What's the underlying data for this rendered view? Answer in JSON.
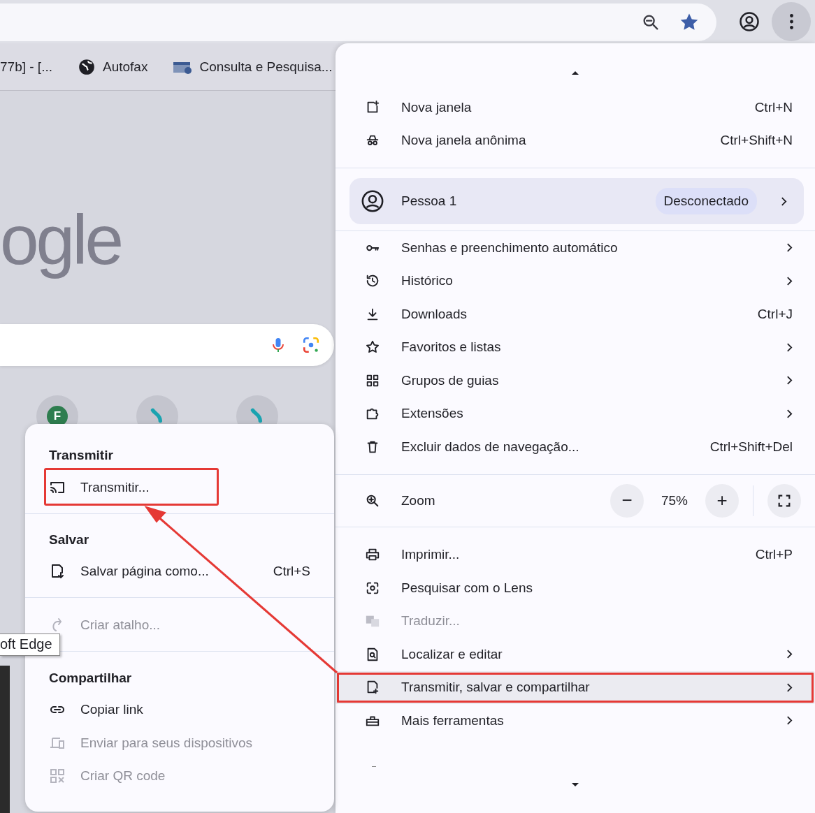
{
  "bookmarks": [
    {
      "label": "77b] - [..."
    },
    {
      "label": "Autofax"
    },
    {
      "label": "Consulta e Pesquisa..."
    }
  ],
  "page": {
    "logo": "ogle",
    "shortcuts": [
      {
        "kind": "letter",
        "letter": "F",
        "color": "#2e7d4f"
      },
      {
        "kind": "logo",
        "color": "#1aa3b0"
      },
      {
        "kind": "logo",
        "color": "#1aa3b0"
      }
    ],
    "tooltip": "oft Edge"
  },
  "menu": {
    "sections": [
      {
        "items": [
          {
            "kind": "item",
            "label": "Nova janela",
            "shortcut": "Ctrl+N",
            "submenu": false,
            "disabled": false,
            "selected": false,
            "annotated": false
          },
          {
            "kind": "item",
            "label": "Nova janela anônima",
            "shortcut": "Ctrl+Shift+N",
            "submenu": false,
            "disabled": false,
            "selected": false,
            "annotated": false
          }
        ]
      },
      {
        "items": [
          {
            "kind": "profile",
            "label": "Pessoa 1",
            "badge": "Desconectado",
            "submenu": true
          }
        ]
      },
      {
        "items": [
          {
            "kind": "item",
            "label": "Senhas e preenchimento automático",
            "submenu": true,
            "disabled": false,
            "selected": false,
            "annotated": false
          },
          {
            "kind": "item",
            "label": "Histórico",
            "submenu": true,
            "disabled": false,
            "selected": false,
            "annotated": false
          },
          {
            "kind": "item",
            "label": "Downloads",
            "shortcut": "Ctrl+J",
            "submenu": false,
            "disabled": false,
            "selected": false,
            "annotated": false
          },
          {
            "kind": "item",
            "label": "Favoritos e listas",
            "submenu": true,
            "disabled": false,
            "selected": false,
            "annotated": false
          },
          {
            "kind": "item",
            "label": "Grupos de guias",
            "submenu": true,
            "disabled": false,
            "selected": false,
            "annotated": false
          },
          {
            "kind": "item",
            "label": "Extensões",
            "submenu": true,
            "disabled": false,
            "selected": false,
            "annotated": false
          },
          {
            "kind": "item",
            "label": "Excluir dados de navegação...",
            "shortcut": "Ctrl+Shift+Del",
            "submenu": false,
            "disabled": false,
            "selected": false,
            "annotated": false
          }
        ]
      },
      {
        "items": [
          {
            "kind": "zoom",
            "label": "Zoom",
            "minus": "−",
            "value": "75%",
            "plus": "+"
          }
        ]
      },
      {
        "items": [
          {
            "kind": "item",
            "label": "Imprimir...",
            "shortcut": "Ctrl+P",
            "submenu": false,
            "disabled": false,
            "selected": false,
            "annotated": false
          },
          {
            "kind": "item",
            "label": "Pesquisar com o Lens",
            "submenu": false,
            "disabled": false,
            "selected": false,
            "annotated": false
          },
          {
            "kind": "item",
            "label": "Traduzir...",
            "submenu": false,
            "disabled": true,
            "selected": false,
            "annotated": false
          },
          {
            "kind": "item",
            "label": "Localizar e editar",
            "submenu": true,
            "disabled": false,
            "selected": false,
            "annotated": false
          },
          {
            "kind": "item",
            "label": "Transmitir, salvar e compartilhar",
            "submenu": true,
            "disabled": false,
            "selected": true,
            "annotated": true
          },
          {
            "kind": "item",
            "label": "Mais ferramentas",
            "submenu": true,
            "disabled": false,
            "selected": false,
            "annotated": false
          }
        ]
      }
    ]
  },
  "submenu": {
    "sections": [
      {
        "heading": "Transmitir",
        "items": [
          {
            "label": "Transmitir...",
            "disabled": false,
            "annotated": true
          }
        ]
      },
      {
        "heading": "Salvar",
        "items": [
          {
            "label": "Salvar página como...",
            "shortcut": "Ctrl+S",
            "disabled": false,
            "annotated": false
          }
        ]
      },
      {
        "items": [
          {
            "label": "Criar atalho...",
            "disabled": true,
            "annotated": false
          }
        ]
      },
      {
        "heading": "Compartilhar",
        "items": [
          {
            "label": "Copiar link",
            "disabled": false,
            "annotated": false
          },
          {
            "label": "Enviar para seus dispositivos",
            "disabled": true,
            "annotated": false
          },
          {
            "label": "Criar QR code",
            "disabled": true,
            "annotated": false
          }
        ]
      }
    ]
  }
}
